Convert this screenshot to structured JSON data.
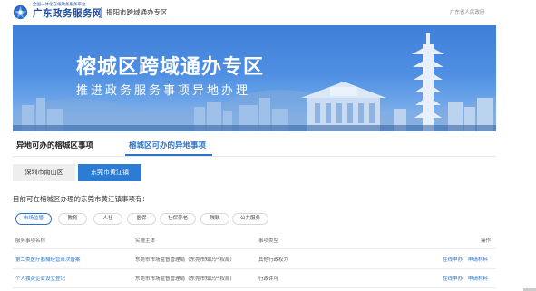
{
  "header": {
    "logo_small": "全国一体化在线政务服务平台",
    "logo_name": "广东政务服务网",
    "zone": "揭阳市跨域通办专区",
    "right_link": "广东省人民政府"
  },
  "banner": {
    "title": "榕城区跨域通办专区",
    "subtitle": "推进政务服务事项异地办理"
  },
  "section_tabs": [
    {
      "label": "异地可办的榕城区事项",
      "active": false
    },
    {
      "label": "榕城区可办的异地事项",
      "active": true
    }
  ],
  "area_tabs": [
    {
      "label": "深圳市南山区",
      "active": false
    },
    {
      "label": "东莞市黄江镇",
      "active": true
    }
  ],
  "intro": "目前可在榕城区办理的东莞市黄江镇事项有：",
  "filters": [
    {
      "label": "市场监管",
      "active": true
    },
    {
      "label": "教育",
      "active": false
    },
    {
      "label": "人社",
      "active": false
    },
    {
      "label": "医保",
      "active": false
    },
    {
      "label": "社保养老",
      "active": false
    },
    {
      "label": "残联",
      "active": false
    },
    {
      "label": "公共服务",
      "active": false
    }
  ],
  "table": {
    "headers": [
      "服务事项名称",
      "实施主体",
      "事项类型",
      "操作"
    ],
    "rows": [
      {
        "name": "第二类医疗器械经营首次备案",
        "dept": "东莞市市场监督管理局（东莞市知识产权局）",
        "type": "其他行政权力",
        "op1": "在线申办",
        "op2": "申请材料"
      },
      {
        "name": "个人独资企业设立登记",
        "dept": "东莞市市场监督管理局（东莞市知识产权局）",
        "type": "行政许可",
        "op1": "在线申办",
        "op2": "申请材料"
      }
    ]
  },
  "colors": {
    "accent": "#2a73c9",
    "brand": "#1f4f9e",
    "active_tab_bg": "#2c7cd6"
  }
}
